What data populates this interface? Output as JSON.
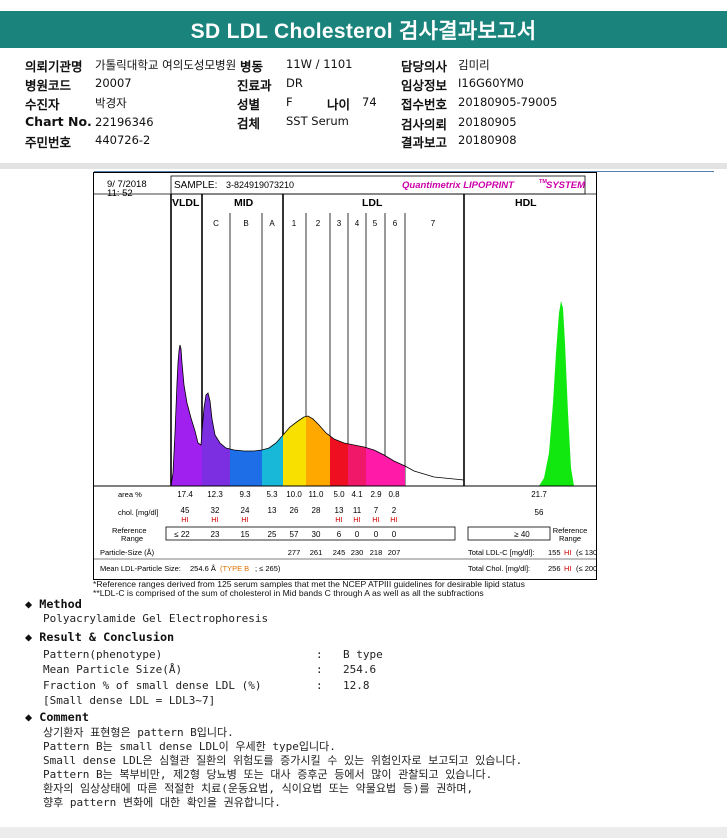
{
  "title": "SD LDL Cholesterol 검사결과보고서",
  "info": {
    "hospital_label": "의뢰기관명",
    "hospital": "가톨릭대학교 여의도성모병원",
    "ward_label": "병동",
    "ward": "11W / 1101",
    "doctor_label": "담당의사",
    "doctor": "김미리",
    "code_label": "병원코드",
    "code": "20007",
    "dept_label": "진료과",
    "dept": "DR",
    "clinical_label": "임상정보",
    "clinical": "I16G60YM0",
    "patient_label": "수진자",
    "patient": "박경자",
    "sex_label": "성별",
    "sex": "F",
    "age_label": "나이",
    "age": "74",
    "receipt_label": "접수번호",
    "receipt": "20180905-79005",
    "chart_label": "Chart No.",
    "chart": "22196346",
    "specimen_label": "검체",
    "specimen": "SST Serum",
    "request_label": "검사의뢰",
    "request": "20180905",
    "id_label": "주민번호",
    "id": "440726-2",
    "report_label": "결과보고",
    "report": "20180908"
  },
  "lipoprint": {
    "date": "9/ 7/2018",
    "time": "11: 52",
    "sample_label": "SAMPLE:",
    "sample": "3-824919073210",
    "brand": "Quantimetrix LIPOPRINT",
    "brand_tm": "TM",
    "brand_system": "SYSTEM",
    "regions": {
      "vldl": "VLDL",
      "mid": "MID",
      "ldl": "LDL",
      "hdl": "HDL"
    },
    "bands": [
      "C",
      "B",
      "A",
      "1",
      "2",
      "3",
      "4",
      "5",
      "6",
      "7"
    ],
    "area_label": "area %",
    "area": [
      "17.4",
      "12.3",
      "9.3",
      "5.3",
      "10.0",
      "11.0",
      "5.0",
      "4.1",
      "2.9",
      "0.8"
    ],
    "area_hdl": "21.7",
    "chol_label": "chol. [mg/dl]",
    "chol": [
      "45",
      "32",
      "24",
      "13",
      "26",
      "28",
      "13",
      "11",
      "7",
      "2"
    ],
    "chol_hdl": "56",
    "hi_flags": [
      "HI",
      "HI",
      "HI",
      "",
      "",
      "",
      "HI",
      "HI",
      "HI",
      "HI"
    ],
    "ref_label_1": "Reference",
    "ref_label_2": "Range",
    "ref": [
      "≤ 22",
      "23",
      "15",
      "25",
      "57",
      "30",
      "6",
      "0",
      "0",
      "0"
    ],
    "ref_hdl": "≥ 40",
    "particle_label": "Particle-Size (Å)",
    "particle": [
      "277",
      "261",
      "245",
      "230",
      "218",
      "207"
    ],
    "mean_label": "Mean LDL-Particle Size:",
    "mean_value": "254.6 Å",
    "mean_type": "(TYPE B",
    "mean_ref": "; ≤ 265)",
    "total_ldl_label": "Total LDL-C [mg/dl]:",
    "total_ldl": "155",
    "total_ldl_flag": "HI",
    "total_ldl_ref": "(≤ 130)",
    "total_chol_label": "Total Chol. [mg/dl]:",
    "total_chol": "256",
    "total_chol_flag": "HI",
    "total_chol_ref": "(≤ 200)"
  },
  "colors": {
    "header": "#1a847c",
    "hi": "#d10000",
    "type": "#e07000",
    "brand": "#cc00aa",
    "vldl": "#a020f0",
    "mid_c": "#7b2fe0",
    "mid_b": "#1e6ee8",
    "mid_a": "#18b8d8",
    "ldl1": "#f8e000",
    "ldl2": "#ffa800",
    "ldl3": "#ee1020",
    "ldl4": "#f01868",
    "ldl5": "#ff1aa8",
    "ldl6": "#ff1aa8",
    "hdl": "#10e810"
  },
  "footnotes": [
    "*Reference ranges derived from 125 serum samples that met the NCEP ATPIII guidelines for desirable lipid status",
    "**LDL-C is comprised of the sum of cholesterol in Mid bands C through A as well as all the subfractions"
  ],
  "method": {
    "heading": "Method",
    "text": "Polyacrylamide Gel Electrophoresis"
  },
  "result": {
    "heading": "Result & Conclusion",
    "rows": [
      {
        "label": "Pattern(phenotype)",
        "value": "B type"
      },
      {
        "label": "Mean Particle Size(Å)",
        "value": "254.6"
      },
      {
        "label": "Fraction % of small dense LDL (%)",
        "value": "12.8"
      }
    ],
    "note": "[Small dense LDL = LDL3~7]"
  },
  "comment": {
    "heading": "Comment",
    "lines": [
      "상기환자 표현형은 pattern B입니다.",
      "Pattern B는 small dense LDL이 우세한 type입니다.",
      "Small dense LDL은 심혈관 질환의 위험도를 증가시킬 수 있는 위험인자로 보고되고 있습니다.",
      "Pattern B는 복부비만, 제2형 당뇨병 또는 대사 증후군 등에서 많이 관찰되고 있습니다.",
      "환자의 임상상태에 따른 적절한 치료(운동요법, 식이요법 또는 약물요법 등)를 권하며,",
      "향후 pattern 변화에 대한 확인을 권유합니다."
    ]
  }
}
